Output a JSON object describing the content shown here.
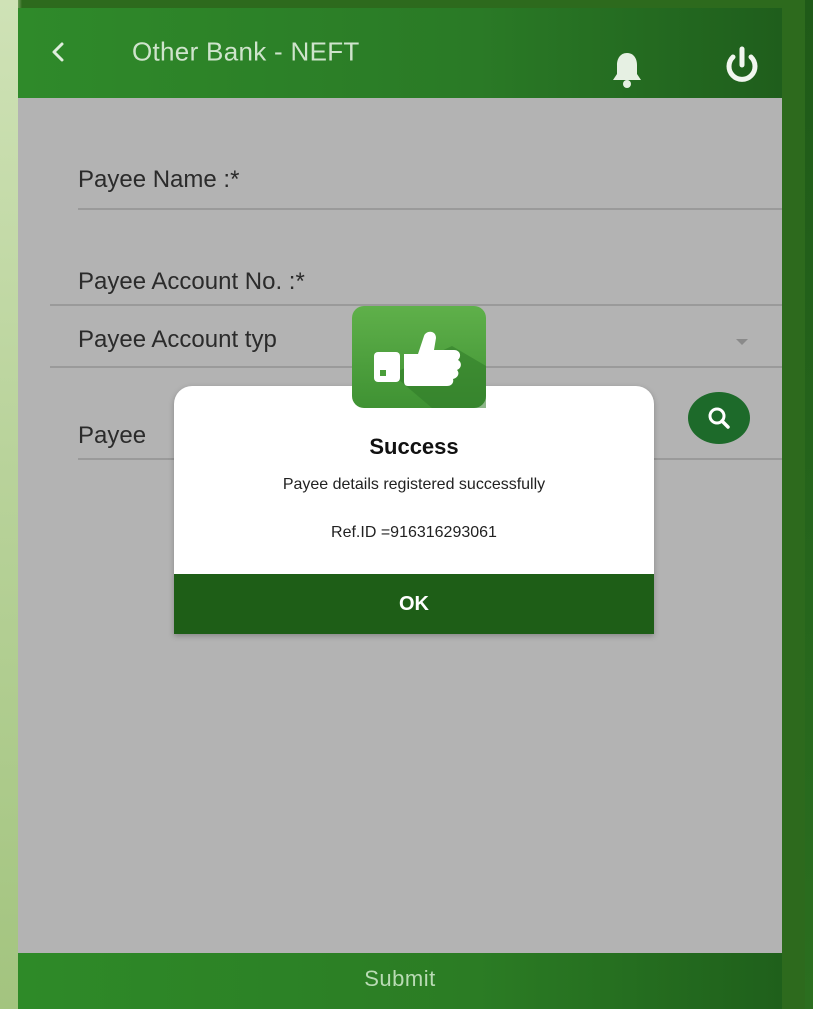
{
  "header": {
    "title": "Other Bank - NEFT",
    "back_icon": "chevron-left-icon",
    "bell_icon": "bell-icon",
    "power_icon": "power-icon"
  },
  "form": {
    "payee_name_label": "Payee Name :*",
    "payee_account_label": "Payee Account No. :*",
    "payee_account_type_label": "Payee Account typ",
    "payee_ifsc_label": "Payee",
    "search_icon": "search-icon"
  },
  "dialog": {
    "icon": "thumbs-up-icon",
    "title": "Success",
    "message": "Payee details registered successfully",
    "reference": "Ref.ID =916316293061",
    "ok_label": "OK"
  },
  "footer": {
    "submit_label": "Submit"
  },
  "colors": {
    "primary_green": "#2a7a26",
    "dark_green": "#1e5e17",
    "badge_green": "#4a9e3a",
    "screen_gray": "#b3b3b3"
  }
}
